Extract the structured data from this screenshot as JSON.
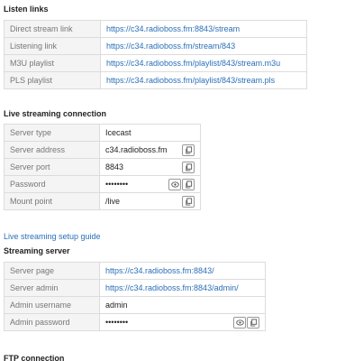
{
  "listen": {
    "title": "Listen links",
    "rows": [
      {
        "label": "Direct stream link",
        "value": "https://c34.radioboss.fm:8843/stream"
      },
      {
        "label": "Listening link",
        "value": "https://c34.radioboss.fm/stream/843"
      },
      {
        "label": "M3U playlist",
        "value": "https://c34.radioboss.fm/playlist/843/stream.m3u"
      },
      {
        "label": "PLS playlist",
        "value": "https://c34.radioboss.fm/playlist/843/stream.pls"
      }
    ]
  },
  "live": {
    "title": "Live streaming connection",
    "rows": [
      {
        "label": "Server type",
        "value": "Icecast"
      },
      {
        "label": "Server address",
        "value": "c34.radioboss.fm"
      },
      {
        "label": "Server port",
        "value": "8843"
      },
      {
        "label": "Password",
        "value": "••••••••"
      },
      {
        "label": "Mount point",
        "value": "/live"
      }
    ],
    "guide_link": "Live streaming setup guide"
  },
  "streaming": {
    "title": "Streaming server",
    "rows": [
      {
        "label": "Server page",
        "value": "https://c34.radioboss.fm:8843/"
      },
      {
        "label": "Server admin",
        "value": "https://c34.radioboss.fm:8843/admin/"
      },
      {
        "label": "Admin username",
        "value": "admin"
      },
      {
        "label": "Admin password",
        "value": "••••••••"
      }
    ]
  },
  "ftp": {
    "title": "FTP connection"
  },
  "icons": {
    "copy": "copy-icon",
    "show": "eye-icon"
  },
  "colors": {
    "link": "#2a6fb8",
    "label_bg": "#f4f4f4",
    "border": "#dcdcdc"
  }
}
